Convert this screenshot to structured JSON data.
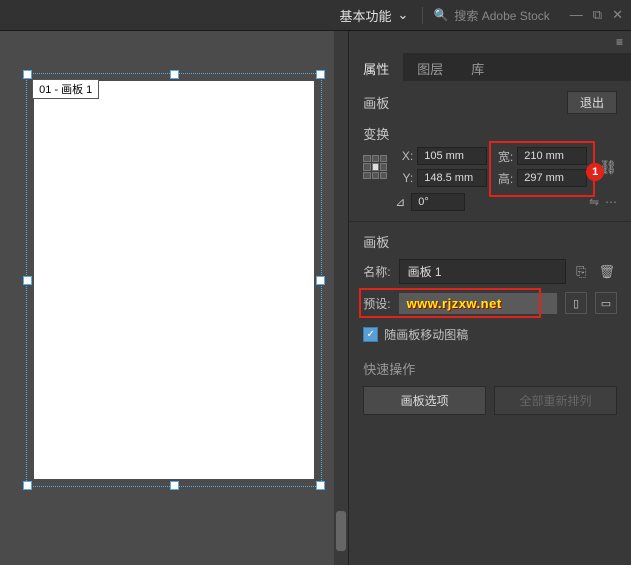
{
  "topbar": {
    "workspace": "基本功能",
    "search_placeholder": "搜索 Adobe Stock"
  },
  "canvas": {
    "artboard_label": "01 - 画板 1"
  },
  "panel": {
    "tabs": [
      "属性",
      "图层",
      "库"
    ],
    "active_tab": 0,
    "section_artboard": "画板",
    "exit": "退出",
    "section_transform": "变换",
    "x_label": "X:",
    "x_val": "105 mm",
    "y_label": "Y:",
    "y_val": "148.5 mm",
    "w_label": "宽:",
    "w_val": "210 mm",
    "h_label": "高:",
    "h_val": "297 mm",
    "angle_val": "0°",
    "badge1": "1",
    "name_label": "名称:",
    "name_val": "画板 1",
    "preset_label": "预设:",
    "preset_val": "www.rjzxw.net",
    "move_art": "随画板移动图稿",
    "quick_title": "快速操作",
    "btn_options": "画板选项",
    "btn_rearrange": "全部重新排列"
  }
}
